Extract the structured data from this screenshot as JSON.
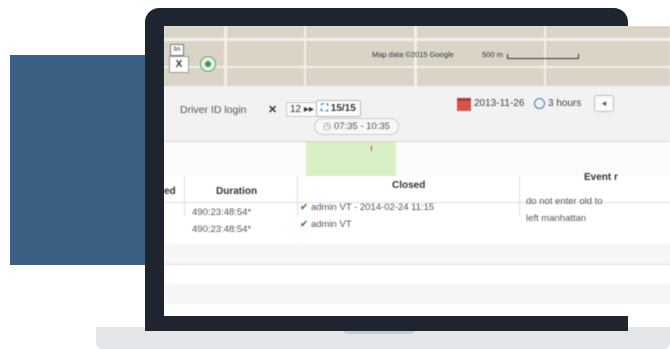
{
  "map": {
    "control_label": "X",
    "shield_label": "9A",
    "credit": "Map data ©2015 Google",
    "scale": "500 m"
  },
  "toolbar": {
    "driver_login": "Driver ID login",
    "clear": "✕",
    "count": "12 ▸▸",
    "page": "15/15",
    "time_range": "07:35 - 10:35",
    "date": "2013-11-26",
    "duration": "3 hours",
    "prev": "◂"
  },
  "table": {
    "headers": {
      "ed": "ed",
      "duration": "Duration",
      "closed": "Closed",
      "event": "Event r"
    },
    "rows": [
      {
        "duration": "490:23:48:54*",
        "closed": "admin VT - 2014-02-24 11:15",
        "event": "do not enter old to"
      },
      {
        "duration": "490:23:48:54*",
        "closed": "admin VT",
        "event": "left manhattan"
      }
    ]
  },
  "colors": {
    "band": "#3a6183",
    "laptop": "#1f2530",
    "timeline_green": "#d8f0c4",
    "check": "#3c9a3c"
  }
}
